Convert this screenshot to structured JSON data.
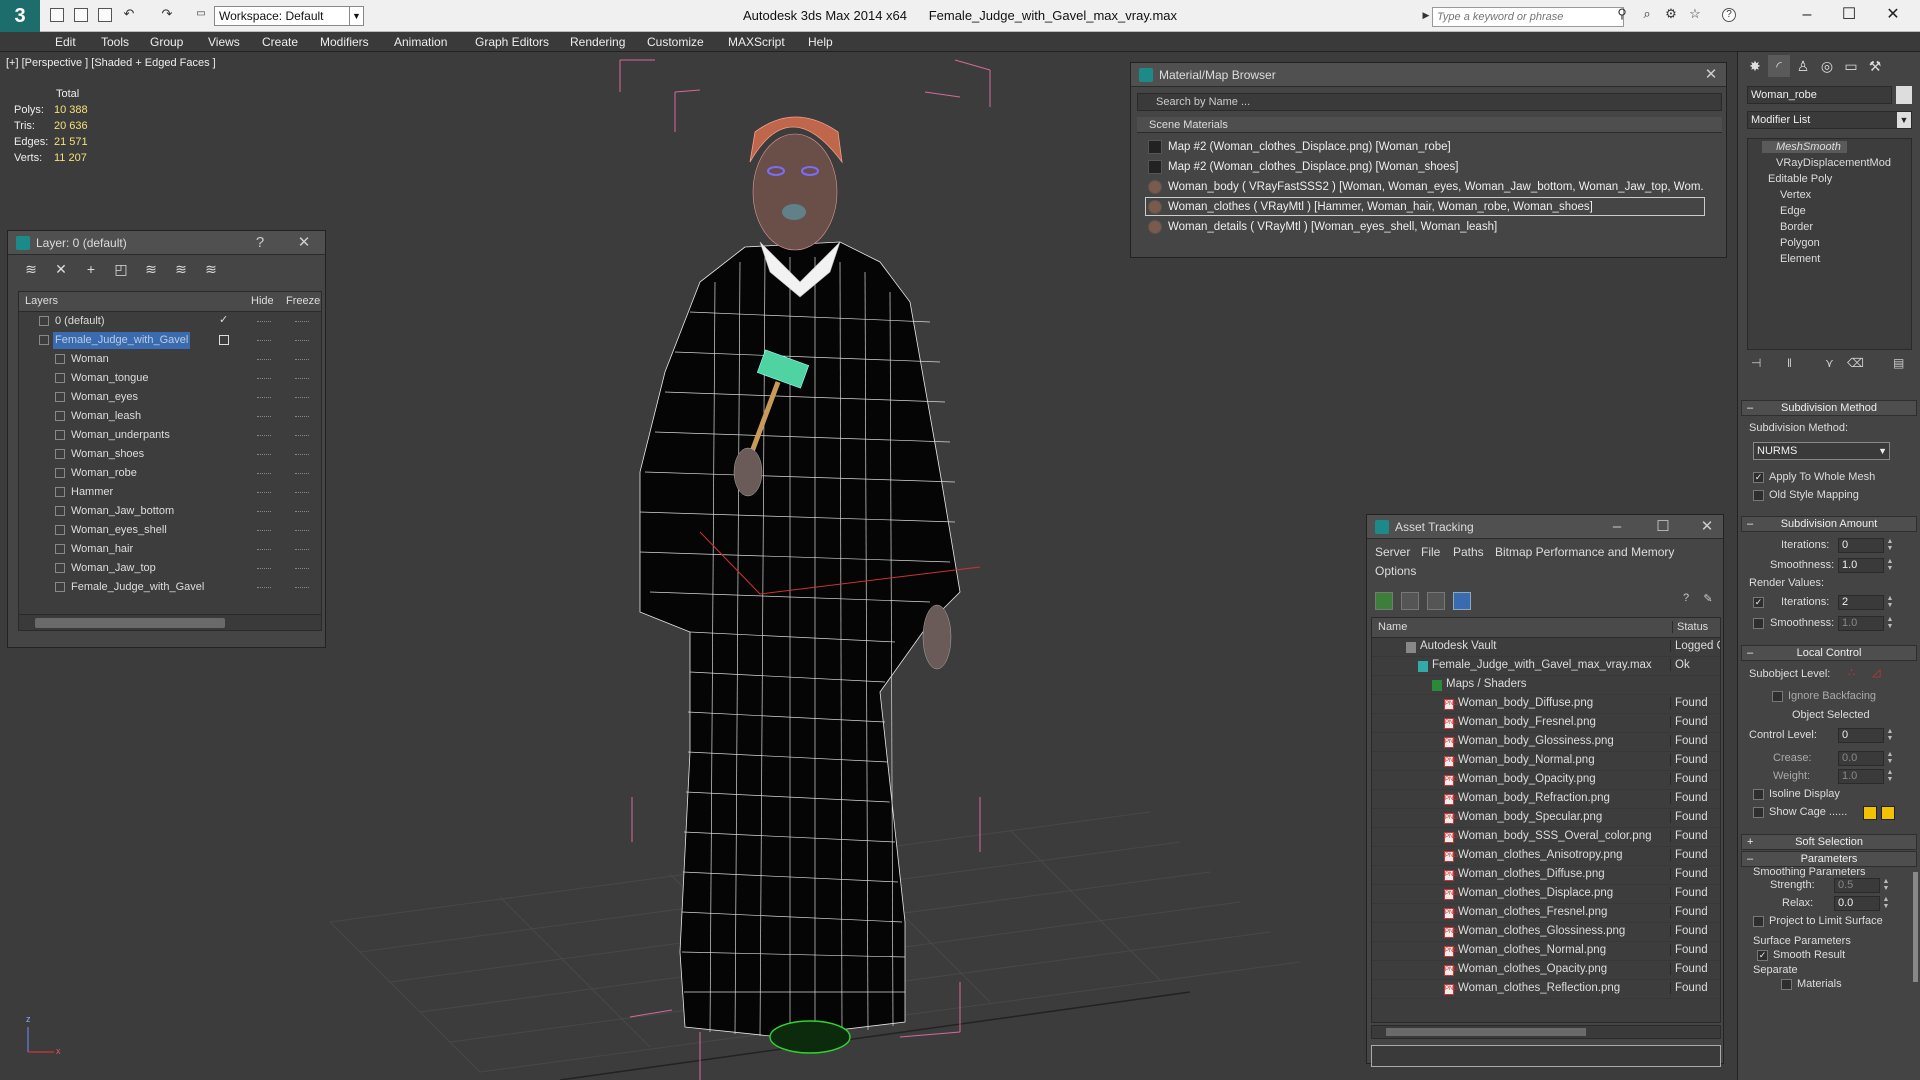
{
  "titlebar": {
    "logo": "3",
    "workspace": "Workspace: Default",
    "app_title": "Autodesk 3ds Max  2014 x64",
    "file_name": "Female_Judge_with_Gavel_max_vray.max",
    "search_placeholder": "Type a keyword or phrase",
    "minimize": "–",
    "maximize": "☐",
    "close": "✕"
  },
  "menu": [
    "Edit",
    "Tools",
    "Group",
    "Views",
    "Create",
    "Modifiers",
    "Animation",
    "Graph Editors",
    "Rendering",
    "Customize",
    "MAXScript",
    "Help"
  ],
  "viewport": {
    "label": "[+] [Perspective ] [Shaded + Edged Faces ]",
    "stats_header": "Total",
    "stats": [
      {
        "k": "Polys:",
        "v": "10 388"
      },
      {
        "k": "Tris:",
        "v": "20 636"
      },
      {
        "k": "Edges:",
        "v": "21 571"
      },
      {
        "k": "Verts:",
        "v": "11 207"
      }
    ],
    "axis_z": "z",
    "axis_x": "x"
  },
  "layer_panel": {
    "title": "Layer: 0 (default)",
    "help": "?",
    "close": "✕",
    "col_layers": "Layers",
    "col_hide": "Hide",
    "col_freeze": "Freeze",
    "rows": [
      {
        "name": "0 (default)",
        "level": 1,
        "check": "✓"
      },
      {
        "name": "Female_Judge_with_Gavel",
        "level": 1,
        "selected": true
      },
      {
        "name": "Woman",
        "level": 2
      },
      {
        "name": "Woman_tongue",
        "level": 2
      },
      {
        "name": "Woman_eyes",
        "level": 2
      },
      {
        "name": "Woman_leash",
        "level": 2
      },
      {
        "name": "Woman_underpants",
        "level": 2
      },
      {
        "name": "Woman_shoes",
        "level": 2
      },
      {
        "name": "Woman_robe",
        "level": 2
      },
      {
        "name": "Hammer",
        "level": 2
      },
      {
        "name": "Woman_Jaw_bottom",
        "level": 2
      },
      {
        "name": "Woman_eyes_shell",
        "level": 2
      },
      {
        "name": "Woman_hair",
        "level": 2
      },
      {
        "name": "Woman_Jaw_top",
        "level": 2
      },
      {
        "name": "Female_Judge_with_Gavel",
        "level": 2
      }
    ]
  },
  "material_browser": {
    "title": "Material/Map Browser",
    "close": "✕",
    "search_placeholder": "Search by Name ...",
    "group": "Scene Materials",
    "rows": [
      {
        "label": "Map #2 (Woman_clothes_Displace.png) [Woman_robe]",
        "kind": "map"
      },
      {
        "label": "Map #2 (Woman_clothes_Displace.png) [Woman_shoes]",
        "kind": "map"
      },
      {
        "label": "Woman_body  ( VRayFastSSS2 )  [Woman, Woman_eyes, Woman_Jaw_bottom, Woman_Jaw_top, Wom...",
        "kind": "mat"
      },
      {
        "label": "Woman_clothes  ( VRayMtl )  [Hammer, Woman_hair, Woman_robe, Woman_shoes]",
        "kind": "mat",
        "selected": true
      },
      {
        "label": "Woman_details  ( VRayMtl )  [Woman_eyes_shell, Woman_leash]",
        "kind": "mat"
      }
    ]
  },
  "asset_tracking": {
    "title": "Asset Tracking",
    "minimize": "–",
    "maximize": "☐",
    "close": "✕",
    "menu": [
      "Server",
      "File",
      "Paths",
      "Bitmap Performance and Memory"
    ],
    "menu2": "Options",
    "col_name": "Name",
    "col_status": "Status",
    "rows": [
      {
        "name": "Autodesk Vault",
        "status": "Logged Out",
        "indent": 34,
        "icon": "vault"
      },
      {
        "name": "Female_Judge_with_Gavel_max_vray.max",
        "status": "Ok",
        "indent": 46,
        "icon": "max"
      },
      {
        "name": "Maps / Shaders",
        "status": "",
        "indent": 60,
        "icon": "folder"
      },
      {
        "name": "Woman_body_Diffuse.png",
        "status": "Found",
        "indent": 72,
        "icon": "png"
      },
      {
        "name": "Woman_body_Fresnel.png",
        "status": "Found",
        "indent": 72,
        "icon": "png"
      },
      {
        "name": "Woman_body_Glossiness.png",
        "status": "Found",
        "indent": 72,
        "icon": "png"
      },
      {
        "name": "Woman_body_Normal.png",
        "status": "Found",
        "indent": 72,
        "icon": "png"
      },
      {
        "name": "Woman_body_Opacity.png",
        "status": "Found",
        "indent": 72,
        "icon": "png"
      },
      {
        "name": "Woman_body_Refraction.png",
        "status": "Found",
        "indent": 72,
        "icon": "png"
      },
      {
        "name": "Woman_body_Specular.png",
        "status": "Found",
        "indent": 72,
        "icon": "png"
      },
      {
        "name": "Woman_body_SSS_Overal_color.png",
        "status": "Found",
        "indent": 72,
        "icon": "png"
      },
      {
        "name": "Woman_clothes_Anisotropy.png",
        "status": "Found",
        "indent": 72,
        "icon": "png"
      },
      {
        "name": "Woman_clothes_Diffuse.png",
        "status": "Found",
        "indent": 72,
        "icon": "png"
      },
      {
        "name": "Woman_clothes_Displace.png",
        "status": "Found",
        "indent": 72,
        "icon": "png"
      },
      {
        "name": "Woman_clothes_Fresnel.png",
        "status": "Found",
        "indent": 72,
        "icon": "png"
      },
      {
        "name": "Woman_clothes_Glossiness.png",
        "status": "Found",
        "indent": 72,
        "icon": "png"
      },
      {
        "name": "Woman_clothes_Normal.png",
        "status": "Found",
        "indent": 72,
        "icon": "png"
      },
      {
        "name": "Woman_clothes_Opacity.png",
        "status": "Found",
        "indent": 72,
        "icon": "png"
      },
      {
        "name": "Woman_clothes_Reflection.png",
        "status": "Found",
        "indent": 72,
        "icon": "png"
      }
    ]
  },
  "command_panel": {
    "object_name": "Woman_robe",
    "modifier_list": "Modifier List",
    "stack": [
      {
        "label": "MeshSmooth",
        "selected": true
      },
      {
        "label": "VRayDisplacementMod"
      },
      {
        "label": "Editable Poly"
      },
      {
        "label": "Vertex"
      },
      {
        "label": "Edge"
      },
      {
        "label": "Border"
      },
      {
        "label": "Polygon"
      },
      {
        "label": "Element"
      }
    ],
    "subdiv_method_title": "Subdivision Method",
    "subdiv_method_label": "Subdivision Method:",
    "subdiv_method_value": "NURMS",
    "apply_whole_mesh": "Apply To Whole Mesh",
    "old_style_mapping": "Old Style Mapping",
    "subdiv_amount_title": "Subdivision Amount",
    "iterations_label": "Iterations:",
    "iterations_value": "0",
    "smoothness_label": "Smoothness:",
    "smoothness_value": "1.0",
    "render_values": "Render Values:",
    "render_iterations_label": "Iterations:",
    "render_iterations_value": "2",
    "render_smoothness_label": "Smoothness:",
    "render_smoothness_value": "1.0",
    "local_control_title": "Local Control",
    "subobject_level": "Subobject Level:",
    "ignore_backfacing": "Ignore Backfacing",
    "object_selected": "Object Selected",
    "control_level_label": "Control Level:",
    "control_level_value": "0",
    "crease_label": "Crease:",
    "crease_value": "0.0",
    "weight_label": "Weight:",
    "weight_value": "1.0",
    "isoline_display": "Isoline Display",
    "show_cage": "Show Cage ......",
    "soft_selection_title": "Soft Selection",
    "parameters_title": "Parameters",
    "smoothing_params": "Smoothing Parameters",
    "strength_label": "Strength:",
    "strength_value": "0.5",
    "relax_label": "Relax:",
    "relax_value": "0.0",
    "project_limit": "Project to Limit Surface",
    "surface_params": "Surface Parameters",
    "smooth_result": "Smooth Result",
    "separate": "Separate",
    "materials": "Materials"
  }
}
